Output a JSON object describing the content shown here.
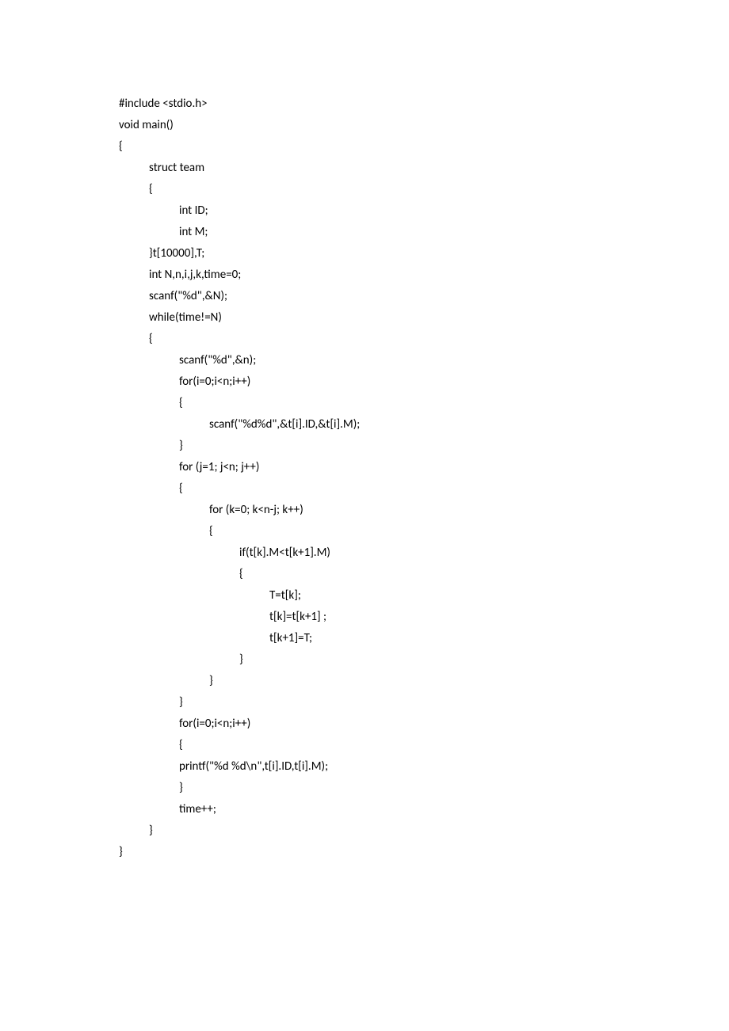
{
  "code": {
    "lines": [
      {
        "indent": 0,
        "text": "#include <stdio.h>"
      },
      {
        "indent": 0,
        "text": "void main()"
      },
      {
        "indent": 0,
        "text": "{"
      },
      {
        "indent": 1,
        "text": "struct team"
      },
      {
        "indent": 1,
        "text": "{"
      },
      {
        "indent": 2,
        "text": "int ID;"
      },
      {
        "indent": 2,
        "text": "int M;"
      },
      {
        "indent": 1,
        "text": "}t[10000],T;"
      },
      {
        "indent": 1,
        "text": "int N,n,i,j,k,time=0;"
      },
      {
        "indent": 1,
        "text": "scanf(\"%d\",&N);"
      },
      {
        "indent": 1,
        "text": "while(time!=N)"
      },
      {
        "indent": 1,
        "text": "{"
      },
      {
        "indent": 2,
        "text": "scanf(\"%d\",&n);"
      },
      {
        "indent": 2,
        "text": "for(i=0;i<n;i++)"
      },
      {
        "indent": 2,
        "text": "{"
      },
      {
        "indent": 3,
        "text": "scanf(\"%d%d\",&t[i].ID,&t[i].M);"
      },
      {
        "indent": 2,
        "text": "}"
      },
      {
        "indent": 2,
        "text": "for (j=1; j<n; j++)"
      },
      {
        "indent": 2,
        "text": "{"
      },
      {
        "indent": 3,
        "text": "for (k=0; k<n-j; k++)"
      },
      {
        "indent": 3,
        "text": "{"
      },
      {
        "indent": 4,
        "text": "if(t[k].M<t[k+1].M)"
      },
      {
        "indent": 4,
        "text": "{"
      },
      {
        "indent": 5,
        "text": "T=t[k];"
      },
      {
        "indent": 5,
        "text": "t[k]=t[k+1] ;"
      },
      {
        "indent": 5,
        "text": "t[k+1]=T;"
      },
      {
        "indent": 4,
        "text": "}"
      },
      {
        "indent": 3,
        "text": "}"
      },
      {
        "indent": 2,
        "text": "}"
      },
      {
        "indent": 2,
        "text": "for(i=0;i<n;i++)"
      },
      {
        "indent": 2,
        "text": "{"
      },
      {
        "indent": 2,
        "text": "printf(\"%d %d\\n\",t[i].ID,t[i].M);"
      },
      {
        "indent": 2,
        "text": "}"
      },
      {
        "indent": 2,
        "text": "time++;"
      },
      {
        "indent": 1,
        "text": "}"
      },
      {
        "indent": 0,
        "text": "}"
      }
    ]
  }
}
